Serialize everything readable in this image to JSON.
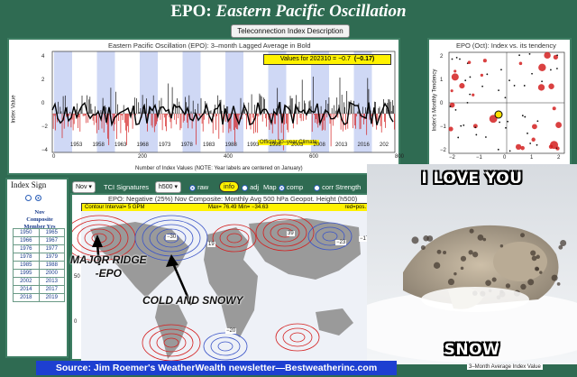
{
  "header": {
    "title_abbr": "EPO:",
    "title_full": "Eastern Pacific Oscillation",
    "description_button": "Teleconnection Index Description"
  },
  "timeseries_panel": {
    "title": "Eastern Pacific Oscillation (EPO): 3–month Lagged Average in Bold",
    "values_box_label": "Values for 202310 = −0.7",
    "values_box_lagged": "(−0.17)",
    "y_axis_label": "Index Value",
    "y_ticks": [
      "4",
      "2",
      "0",
      "−2",
      "−4"
    ],
    "year_labels": [
      "1953",
      "1958",
      "1963",
      "1968",
      "1973",
      "1978",
      "1983",
      "1988",
      "1993",
      "1998",
      "2003",
      "2008",
      "2013",
      "2016",
      "202"
    ],
    "x_ticks": [
      "0",
      "200",
      "400",
      "600",
      "800"
    ],
    "climate_label": "Official 30–year Climate",
    "x_axis_label": "Number of Index Values (NOTE: Year labels are centered on January)"
  },
  "scatter_panel": {
    "title": "EPO (Oct): Index vs. its tendency",
    "y_axis_label": "Index's Monthly Tendency",
    "y_ticks": [
      "2",
      "1",
      "0",
      "−1",
      "−2"
    ],
    "x_ticks": [
      "−2",
      "−1",
      "0",
      "1",
      "2"
    ]
  },
  "sidebar": {
    "heading": "Index Sign",
    "composite_heading": "Nov\nComposite\nMember Yrs",
    "years": [
      [
        "1950",
        "1965"
      ],
      [
        "1966",
        "1967"
      ],
      [
        "1976",
        "1977"
      ],
      [
        "1978",
        "1979"
      ],
      [
        "1985",
        "1988"
      ],
      [
        "1995",
        "2000"
      ],
      [
        "2002",
        "2013"
      ],
      [
        "2014",
        "2017"
      ],
      [
        "2018",
        "2019"
      ]
    ]
  },
  "map_toolbar": {
    "month": "Nov",
    "tci_label": "TCI Signatures",
    "level": "h500",
    "raw": "raw",
    "info": "info",
    "adj": "adj",
    "map": "Map",
    "comp": "comp",
    "corr": "corr",
    "strength": "Strength"
  },
  "map_panel": {
    "title": "EPO: Negative (25%) Nov Composite: Monthly Avg 500 hPa Geopot. Height (h500)",
    "contour_interval": "Contour Interval= 5 GPM",
    "max_min": "Max= 76.49  Min= −34.63",
    "red_pos": "red=pos.",
    "contour_labels": [
      "−30",
      "19",
      "39",
      "−23",
      "−17",
      "−20"
    ],
    "lat_labels": [
      "50",
      "0"
    ],
    "annotation_ridge": "MAJOR RIDGE\n-EPO",
    "annotation_cold": "COLD AND SNOWY",
    "bottom_caption": "3–Month Average Index Value"
  },
  "meme": {
    "top_text": "I LOVE YOU",
    "bottom_text": "SNOW"
  },
  "footer": {
    "source": "Source: Jim Roemer's WeatherWealth newsletter—Bestweatherinc.com"
  },
  "colors": {
    "page_bg": "#2f6b52",
    "bar_blue": "#cfd8f5",
    "pos_red": "#d42020",
    "neg_blue": "#3a54c8",
    "source_bar": "#1d3fd1",
    "values_box": "#fff200"
  }
}
